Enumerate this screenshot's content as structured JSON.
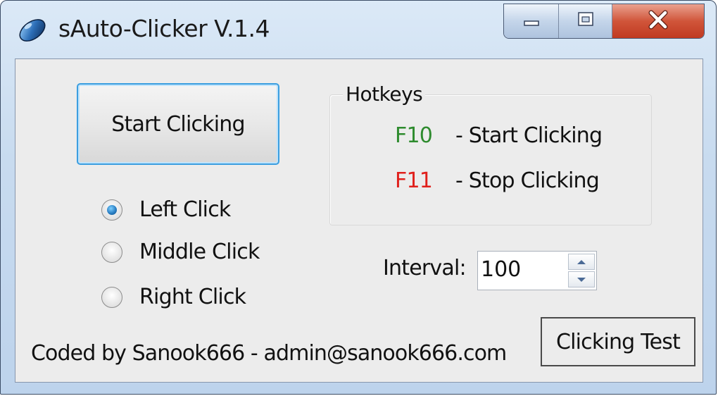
{
  "window": {
    "title": "sAuto-Clicker V.1.4",
    "icon": "mouse-icon"
  },
  "caption": {
    "minimize_icon": "minimize-icon",
    "maximize_icon": "maximize-icon",
    "close_icon": "close-icon"
  },
  "main": {
    "start_button_label": "Start Clicking",
    "click_options": [
      {
        "label": "Left Click",
        "selected": true
      },
      {
        "label": "Middle Click",
        "selected": false
      },
      {
        "label": "Right Click",
        "selected": false
      }
    ],
    "hotkeys": {
      "legend": "Hotkeys",
      "items": [
        {
          "key": "F10",
          "description": "- Start Clicking",
          "color": "#2e8b2e"
        },
        {
          "key": "F11",
          "description": "- Stop Clicking",
          "color": "#e0201c"
        }
      ]
    },
    "interval": {
      "label": "Interval:",
      "value": "100"
    },
    "test_button_label": "Clicking Test",
    "footer": "Coded by Sanook666 - admin@sanook666.com"
  },
  "colors": {
    "accent": "#3b9ee0",
    "close": "#c8432a"
  }
}
